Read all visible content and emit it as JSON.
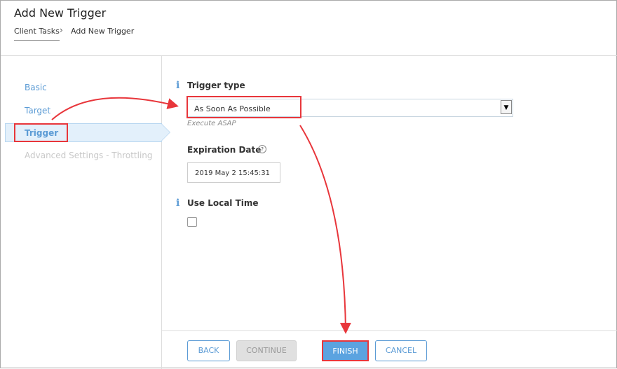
{
  "header": {
    "title": "Add New Trigger",
    "breadcrumb": [
      "Client Tasks",
      "Add New Trigger"
    ]
  },
  "sidebar": {
    "items": [
      {
        "label": "Basic"
      },
      {
        "label": "Target"
      },
      {
        "label": "Trigger",
        "selected": true
      },
      {
        "label": "Advanced Settings - Throttling",
        "disabled": true
      }
    ]
  },
  "form": {
    "trigger_type": {
      "label": "Trigger type",
      "value": "As Soon As Possible",
      "hint": "Execute ASAP"
    },
    "expiration": {
      "label": "Expiration Date",
      "value": "2019 May 2 15:45:31"
    },
    "local_time": {
      "label": "Use Local Time",
      "checked": false
    }
  },
  "footer": {
    "back": "BACK",
    "continue": "CONTINUE",
    "finish": "FINISH",
    "cancel": "CANCEL"
  },
  "colors": {
    "accent": "#5b9bd5",
    "highlight": "#e8363b"
  }
}
